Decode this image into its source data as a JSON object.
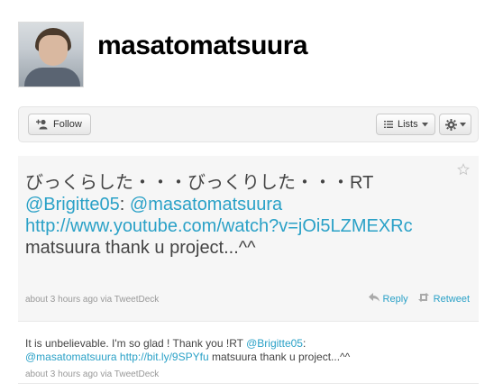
{
  "profile": {
    "screen_name": "masatomatsuura"
  },
  "toolbar": {
    "follow_label": "Follow",
    "lists_label": "Lists",
    "follow_icon": "add-user-icon",
    "lists_icon": "list-icon",
    "gear_icon": "gear-icon"
  },
  "featured_tweet": {
    "text_prefix": "びっくらした・・・びっくりした・・・RT ",
    "mention_1": "@Brigitte05",
    "separator_1": ": ",
    "mention_2": "@masatomatsuura",
    "space": " ",
    "url": "http://www.youtube.com/watch?v=jOi5LZMEXRc",
    "text_suffix": " matsuura thank u project...^^",
    "timestamp": "about 3 hours ago",
    "via_prefix": " via ",
    "client": "TweetDeck",
    "reply_label": "Reply",
    "retweet_label": "Retweet"
  },
  "tweet_2": {
    "text_prefix": "It is unbelievable. I'm so glad ! Thank you !RT ",
    "mention_1": "@Brigitte05",
    "separator_1": ": ",
    "mention_2": "@masatomatsuura",
    "space": " ",
    "url": "http://bit.ly/9SPYfu",
    "text_suffix": " matsuura thank u project...^^",
    "timestamp": "about 3 hours ago",
    "via_prefix": " via ",
    "client": "TweetDeck"
  },
  "colors": {
    "link": "#2aa1c7",
    "featured_bg": "#f6f6f6",
    "toolbar_bg": "#f4f4f4"
  }
}
